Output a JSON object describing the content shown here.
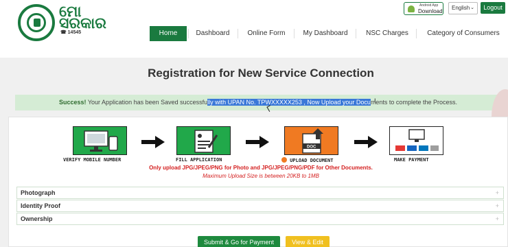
{
  "header": {
    "brand_line1": "ମୋ",
    "brand_line2": "ସରକାର",
    "brand_number": "☎ 14545",
    "android_small": "Android App",
    "android_label": "Download",
    "language": "English",
    "logout_label": "Logout"
  },
  "nav": {
    "items": [
      "Home",
      "Dashboard",
      "Online Form",
      "My Dashboard",
      "NSC Charges",
      "Category of Consumers"
    ],
    "active": "Home"
  },
  "page_title": "Registration for New Service Connection",
  "alert": {
    "strong": "Success!",
    "part1": " Your Application has been Saved successfu",
    "highlight": "lly with UPAN No. TPWXXXXX253 , Now Upload your Docu",
    "part2": "ments to complete the Process."
  },
  "steps": [
    {
      "label": "VERIFY MOBILE NUMBER",
      "icon": "computer-phone-icon",
      "color": "#21a84a"
    },
    {
      "label": "FILL APPLICATION",
      "icon": "form-pen-icon",
      "color": "#21a84a"
    },
    {
      "label": "UPLOAD DOCUMENT",
      "icon": "upload-document-icon",
      "color": "#f07a22"
    },
    {
      "label": "MAKE PAYMENT",
      "icon": "payment-cards-icon",
      "color": "#ffffff"
    }
  ],
  "upload_notice": "Only upload JPG/JPEG/PNG for Photo and JPG/JPEG/PNG/PDF for Other Documents.",
  "upload_size_notice": "Maximum Upload Size is between 20KB to 1MB",
  "sections": [
    "Photograph",
    "Identity Proof",
    "Ownership"
  ],
  "buttons": {
    "submit": "Submit & Go for Payment",
    "edit": "View & Edit"
  },
  "colors": {
    "brand_green": "#1a7a3f",
    "alert_bg": "#d5ecd5",
    "warning_red": "#d42020",
    "upload_orange": "#f07a22",
    "edit_yellow": "#f0c020"
  }
}
